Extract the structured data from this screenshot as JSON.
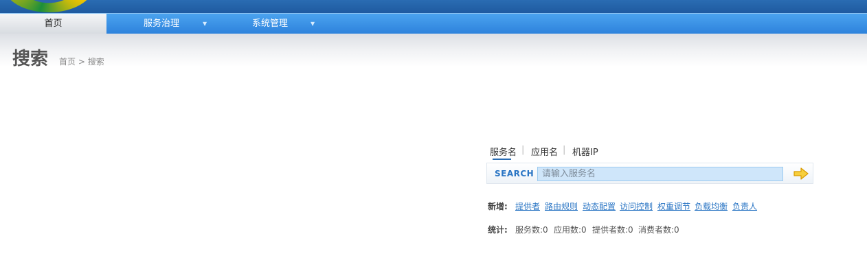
{
  "nav": {
    "items": [
      {
        "label": "首页",
        "active": true
      },
      {
        "label": "服务治理",
        "has_dropdown": true
      },
      {
        "label": "系统管理",
        "has_dropdown": true
      }
    ]
  },
  "page": {
    "title": "搜索",
    "breadcrumb": {
      "home": "首页",
      "separator": ">",
      "current": "搜索"
    }
  },
  "search": {
    "tabs": [
      {
        "label": "服务名",
        "active": true
      },
      {
        "label": "应用名"
      },
      {
        "label": "机器IP"
      }
    ],
    "tab_separator": "|",
    "label": "SEARCH",
    "placeholder": "请输入服务名",
    "value": "",
    "go_icon": "arrow-right-icon"
  },
  "create": {
    "label": "新增:",
    "links": [
      "提供者",
      "路由规则",
      "动态配置",
      "访问控制",
      "权重调节",
      "负载均衡",
      "负责人"
    ]
  },
  "stats": {
    "label": "统计:",
    "items": [
      "服务数:0",
      "应用数:0",
      "提供者数:0",
      "消费者数:0"
    ]
  },
  "colors": {
    "nav_blue": "#2d82dc",
    "topbar_blue": "#1f5aa0",
    "link_blue": "#2a75c4",
    "search_arrow": "#f0b400"
  }
}
